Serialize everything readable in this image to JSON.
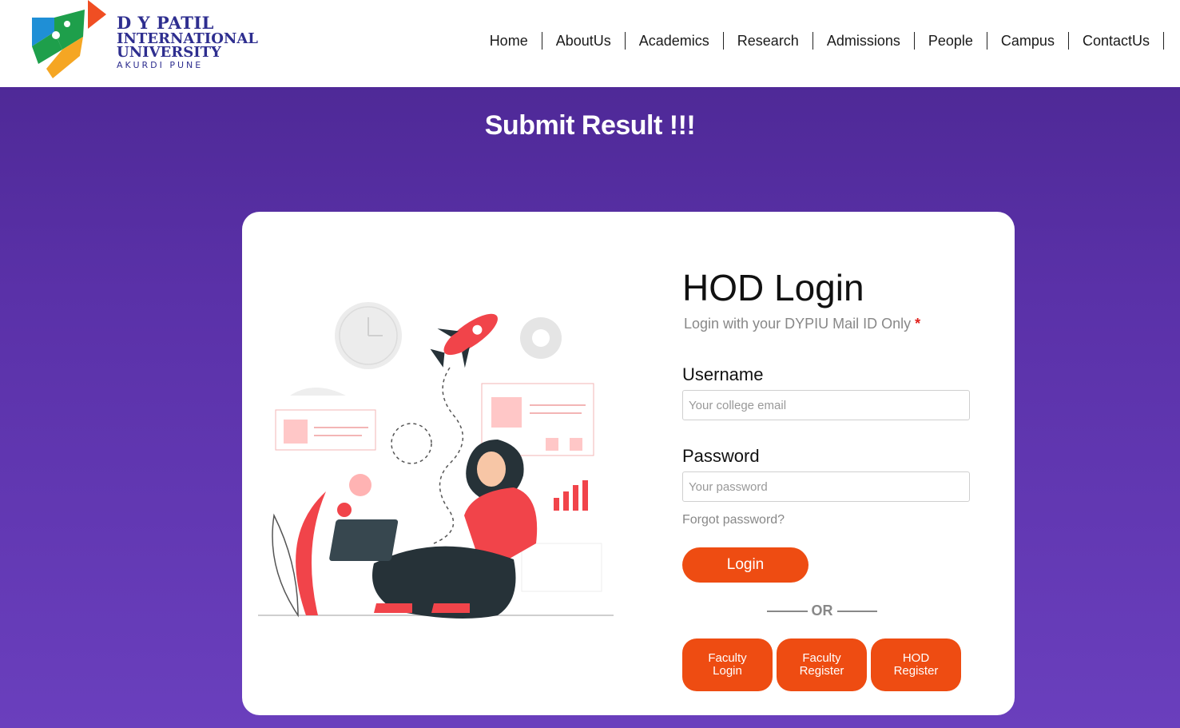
{
  "brand": {
    "line1": "D Y PATIL",
    "line2": "INTERNATIONAL",
    "line3": "UNIVERSITY",
    "line4": "AKURDI PUNE",
    "colors": {
      "navy": "#2e2e8f",
      "green": "#1e9f4b",
      "orange": "#f5a623",
      "red": "#f04e23",
      "blue": "#1f8fd6"
    }
  },
  "nav": {
    "items": [
      "Home",
      "AboutUs",
      "Academics",
      "Research",
      "Admissions",
      "People",
      "Campus",
      "ContactUs"
    ]
  },
  "page": {
    "title": "Submit Result !!!"
  },
  "login": {
    "title": "HOD Login",
    "subtitle": "Login with your DYPIU Mail ID Only",
    "required_mark": "*",
    "username_label": "Username",
    "username_placeholder": "Your college email",
    "password_label": "Password",
    "password_placeholder": "Your password",
    "forgot": "Forgot password?",
    "submit": "Login",
    "or": "OR",
    "alt_buttons": [
      "Faculty Login",
      "Faculty Register",
      "HOD Register"
    ]
  },
  "theme": {
    "accent": "#ee4c12",
    "background_top": "#4a2690",
    "background_bottom": "#6a3fbd"
  }
}
